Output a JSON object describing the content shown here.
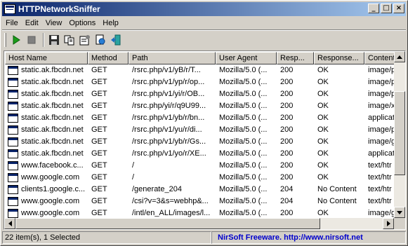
{
  "window": {
    "title": "HTTPNetworkSniffer"
  },
  "title_buttons": {
    "minimize": "_",
    "maximize": "□",
    "close": "×"
  },
  "menu": [
    {
      "label": "File"
    },
    {
      "label": "Edit"
    },
    {
      "label": "View"
    },
    {
      "label": "Options"
    },
    {
      "label": "Help"
    }
  ],
  "toolbar": {
    "icons": [
      "start-capture-icon",
      "stop-capture-icon",
      "save-icon",
      "copy-icon",
      "properties-icon",
      "html-report-icon",
      "exit-icon"
    ],
    "colors": {
      "start": "#1a9c1a",
      "stop": "#707070"
    }
  },
  "table": {
    "columns": [
      "Host Name",
      "Method",
      "Path",
      "User Agent",
      "Resp...",
      "Response...",
      "Content"
    ],
    "rows": [
      {
        "host": "static.ak.fbcdn.net",
        "method": "GET",
        "path": "/rsrc.php/v1/yB/r/T...",
        "ua": "Mozilla/5.0 (...",
        "resp": "200",
        "status": "OK",
        "ct": "image/p"
      },
      {
        "host": "static.ak.fbcdn.net",
        "method": "GET",
        "path": "/rsrc.php/v1/yp/r/op...",
        "ua": "Mozilla/5.0 (...",
        "resp": "200",
        "status": "OK",
        "ct": "image/p"
      },
      {
        "host": "static.ak.fbcdn.net",
        "method": "GET",
        "path": "/rsrc.php/v1/yi/r/OB...",
        "ua": "Mozilla/5.0 (...",
        "resp": "200",
        "status": "OK",
        "ct": "image/p"
      },
      {
        "host": "static.ak.fbcdn.net",
        "method": "GET",
        "path": "/rsrc.php/yi/r/q9U99...",
        "ua": "Mozilla/5.0 (...",
        "resp": "200",
        "status": "OK",
        "ct": "image/x"
      },
      {
        "host": "static.ak.fbcdn.net",
        "method": "GET",
        "path": "/rsrc.php/v1/yb/r/bn...",
        "ua": "Mozilla/5.0 (...",
        "resp": "200",
        "status": "OK",
        "ct": "applicat"
      },
      {
        "host": "static.ak.fbcdn.net",
        "method": "GET",
        "path": "/rsrc.php/v1/yu/r/di...",
        "ua": "Mozilla/5.0 (...",
        "resp": "200",
        "status": "OK",
        "ct": "image/p"
      },
      {
        "host": "static.ak.fbcdn.net",
        "method": "GET",
        "path": "/rsrc.php/v1/yb/r/Gs...",
        "ua": "Mozilla/5.0 (...",
        "resp": "200",
        "status": "OK",
        "ct": "image/g"
      },
      {
        "host": "static.ak.fbcdn.net",
        "method": "GET",
        "path": "/rsrc.php/v1/yo/r/XE...",
        "ua": "Mozilla/5.0 (...",
        "resp": "200",
        "status": "OK",
        "ct": "applicat"
      },
      {
        "host": "www.facebook.c...",
        "method": "GET",
        "path": "/",
        "ua": "Mozilla/5.0 (...",
        "resp": "200",
        "status": "OK",
        "ct": "text/htr"
      },
      {
        "host": "www.google.com",
        "method": "GET",
        "path": "/",
        "ua": "Mozilla/5.0 (...",
        "resp": "200",
        "status": "OK",
        "ct": "text/htr"
      },
      {
        "host": "clients1.google.c...",
        "method": "GET",
        "path": "/generate_204",
        "ua": "Mozilla/5.0 (...",
        "resp": "204",
        "status": "No Content",
        "ct": "text/htr"
      },
      {
        "host": "www.google.com",
        "method": "GET",
        "path": "/csi?v=3&s=webhp&...",
        "ua": "Mozilla/5.0 (...",
        "resp": "204",
        "status": "No Content",
        "ct": "text/htr"
      },
      {
        "host": "www.google.com",
        "method": "GET",
        "path": "/intl/en_ALL/images/l...",
        "ua": "Mozilla/5.0 (...",
        "resp": "200",
        "status": "OK",
        "ct": "image/g"
      }
    ]
  },
  "status_bar": {
    "count": "22 item(s), 1 Selected",
    "link": "NirSoft Freeware.  http://www.nirsoft.net"
  }
}
